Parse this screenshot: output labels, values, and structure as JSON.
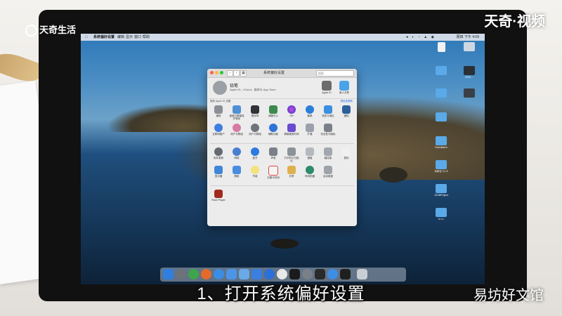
{
  "watermarks": {
    "top_left": "天奇生活",
    "top_right": "天奇·视频",
    "bottom_right": "易坊好文馆"
  },
  "subtitle": "1、打开系统偏好设置",
  "menubar": {
    "app": "系统偏好设置",
    "menus": [
      "编辑",
      "显示",
      "窗口",
      "帮助"
    ],
    "clock": "周四 下午 4:09"
  },
  "prefs_window": {
    "title": "系统偏好设置",
    "search_placeholder": "搜索",
    "account_name": "铅笔",
    "account_sub": "Apple ID、iCloud、媒体与 App Store",
    "apple_id_label": "Apple ID",
    "family_label": "家人共享",
    "notice": "更新 Apple ID 设置",
    "notice_link": "再检查更新",
    "row1": [
      "通用",
      "桌面与屏幕保护程序",
      "程序坞",
      "调度中心",
      "Siri",
      "聚焦",
      "语言与地区",
      "通知"
    ],
    "row2": [
      "互联网账户",
      "用户与群组",
      "辅助功能",
      "屏幕使用时间",
      "扩展",
      "安全性与隐私"
    ],
    "row3": [
      "软件更新",
      "网络",
      "蓝牙",
      "声音",
      "打印机与扫描仪",
      "键盘",
      "触控板",
      "鼠标"
    ],
    "row4": [
      "显示器",
      "随航",
      "节能",
      "日期与时间",
      "共享",
      "时间机器",
      "启动磁盘"
    ],
    "row5": [
      "Flash Player"
    ]
  },
  "desktop_icons": [
    "",
    "",
    "",
    "2020-...",
    "",
    "",
    "",
    "RoboBatch",
    "",
    "未命名 9.1.5",
    "",
    "JCDBProject",
    "",
    "6.1.1"
  ],
  "colors": {
    "accent": "#2a6ae0",
    "red": "#ff5f57",
    "yellow": "#febc2e",
    "green": "#28c840"
  }
}
